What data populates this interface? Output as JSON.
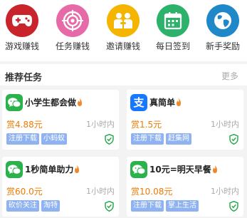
{
  "nav": [
    {
      "label": "游戏赚钱",
      "icon": "gamepad-icon",
      "color": "#c9232b"
    },
    {
      "label": "任务赚钱",
      "icon": "target-icon",
      "color": "#e66aa8"
    },
    {
      "label": "邀请赚钱",
      "icon": "invite-people-icon",
      "color": "#f4b400"
    },
    {
      "label": "每日签到",
      "icon": "calendar-icon",
      "color": "#2cb26b"
    },
    {
      "label": "新手奖励",
      "icon": "globe-icon",
      "color": "#1e88c8"
    }
  ],
  "section": {
    "title": "推荐任务",
    "more": "更多"
  },
  "tasks": [
    {
      "name": "小学生都会做",
      "icon": "wechat-icon",
      "price": "赏4.88元",
      "time": "1小时内",
      "tags": [
        "注册下载",
        "小蚂蚁"
      ]
    },
    {
      "name": "真简单",
      "icon": "alipay-icon",
      "price": "赏1.5元",
      "time": "1小时内",
      "tags": [
        "注册下载",
        "赶集网"
      ]
    },
    {
      "name": "1秒简单助力",
      "icon": "wechat-icon",
      "price": "赏60.0元",
      "time": "1小时内",
      "tags": [
        "砍价关注",
        "淘特"
      ]
    },
    {
      "name": "10元=明天早餐",
      "icon": "wechat-icon",
      "price": "赏10.08元",
      "time": "1小时内",
      "tags": [
        "注册下载",
        "掌上生活"
      ]
    }
  ],
  "colors": {
    "price": "#f07a00",
    "tag": "#8fb2f0",
    "shield": "#1fa647",
    "wechat": "#2bb24c",
    "alipay": "#1677ff"
  }
}
